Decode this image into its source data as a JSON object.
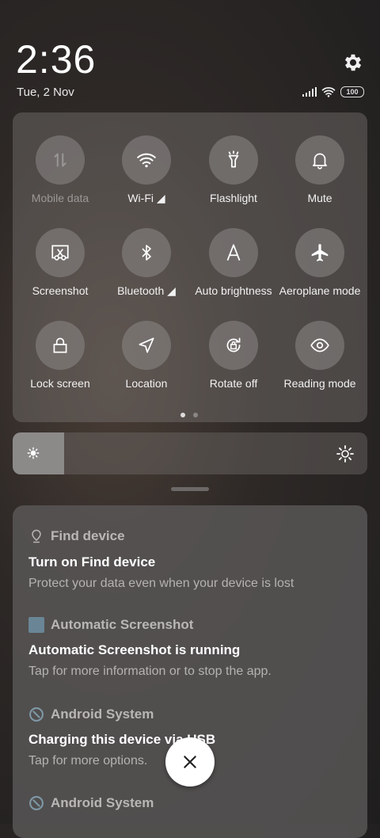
{
  "header": {
    "time": "2:36",
    "date": "Tue, 2 Nov",
    "battery": "100",
    "icons": [
      "settings-gear-icon",
      "signal-icon",
      "wifi-icon",
      "battery-icon"
    ]
  },
  "quick_settings": {
    "tiles": [
      {
        "label": "Mobile data",
        "icon": "mobile-data-icon",
        "enabled": false
      },
      {
        "label": "Wi-Fi ◢",
        "icon": "wifi-icon",
        "enabled": true
      },
      {
        "label": "Flashlight",
        "icon": "flashlight-icon",
        "enabled": true
      },
      {
        "label": "Mute",
        "icon": "bell-icon",
        "enabled": true
      },
      {
        "label": "Screenshot",
        "icon": "screenshot-icon",
        "enabled": true
      },
      {
        "label": "Bluetooth ◢",
        "icon": "bluetooth-icon",
        "enabled": true
      },
      {
        "label": "Auto brightness",
        "icon": "auto-brightness-icon",
        "enabled": true
      },
      {
        "label": "Aeroplane mode",
        "icon": "airplane-icon",
        "enabled": true
      },
      {
        "label": "Lock screen",
        "icon": "lock-icon",
        "enabled": true
      },
      {
        "label": "Location",
        "icon": "location-icon",
        "enabled": true
      },
      {
        "label": "Rotate off",
        "icon": "rotate-lock-icon",
        "enabled": true
      },
      {
        "label": "Reading mode",
        "icon": "eye-icon",
        "enabled": true
      }
    ],
    "page_count": 2,
    "current_page": 1
  },
  "brightness": {
    "level_fraction": 0.145
  },
  "notifications": [
    {
      "app": "Find device",
      "title": "Turn on Find device",
      "body": "Protect your data even when your device is lost",
      "icon": "location-pin-icon"
    },
    {
      "app": "Automatic Screenshot",
      "title": "Automatic Screenshot is running",
      "body": "Tap for more information or to stop the app.",
      "icon": "app-square-icon"
    },
    {
      "app": "Android System",
      "title": "Charging this device via USB",
      "body": "Tap for more options.",
      "icon": "android-system-icon"
    },
    {
      "app": "Android System",
      "title": "",
      "body": "",
      "icon": "android-system-icon"
    }
  ],
  "close_button_icon": "close-icon"
}
